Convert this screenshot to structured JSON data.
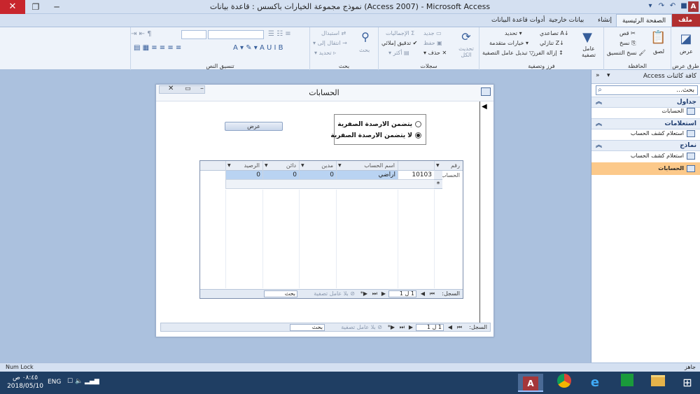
{
  "window": {
    "title": "نموذج مجموعة الخيارات باكسس : قاعدة بيانات (Access 2007) - Microsoft Access",
    "close_glyph": "✕",
    "max_glyph": "❐",
    "min_glyph": "─"
  },
  "ribbon": {
    "tabs": [
      "ملف",
      "الصفحة الرئيسية",
      "إنشاء",
      "بيانات خارجية",
      "أدوات قاعدة البيانات"
    ],
    "groups": {
      "views": {
        "title": "طرق عرض",
        "view_label": "عرض"
      },
      "clipboard": {
        "title": "الحافظة",
        "paste": "لصق",
        "cut": "قص",
        "copy": "نسخ",
        "format_painter": "نسخ التنسيق"
      },
      "sort_filter": {
        "title": "فرز وتصفية",
        "filter": "عامل تصفية",
        "ascending": "تصاعدي",
        "descending": "تنازلي",
        "remove_sort": "إزالة الفرز",
        "selection": "تحديد",
        "advanced": "خيارات متقدمة",
        "toggle_filter": "تبديل عامل التصفية"
      },
      "records": {
        "title": "سجلات",
        "refresh": "تحديث الكل",
        "new": "جديد",
        "save": "حفظ",
        "delete": "حذف",
        "totals": "الإجماليات",
        "spelling": "تدقيق إملائي",
        "more": "أكثر"
      },
      "find": {
        "title": "بحث",
        "find": "بحث",
        "replace": "استبدال",
        "goto": "انتقال إلى",
        "select": "تحديد"
      },
      "text_format": {
        "title": "تنسيق النص"
      }
    }
  },
  "nav_pane": {
    "title": "كافة كائنات Access",
    "search_placeholder": "بحث...",
    "sections": [
      {
        "label": "جداول",
        "items": [
          "الحسابات"
        ]
      },
      {
        "label": "استعلامات",
        "items": [
          "استعلام كشف الحساب"
        ]
      },
      {
        "label": "نماذج",
        "items": [
          "استعلام كشف الحساب",
          "الحسابات"
        ]
      }
    ]
  },
  "form": {
    "title": "الحسابات",
    "options": [
      {
        "label": "يتضمن الارصدة الصفرية",
        "selected": false
      },
      {
        "label": "لا يتضمن الارصدة الصفرية",
        "selected": true
      }
    ],
    "show_button": "عرض",
    "datasheet": {
      "columns": [
        "رقم الحساب",
        "اسم الحساب",
        "مدين",
        "دائن",
        "الرصيد"
      ],
      "rows": [
        [
          "10103",
          "اراضي",
          "0",
          "0",
          "0"
        ]
      ],
      "new_row_marker": "*"
    },
    "sub_nav": {
      "record_label": "السجل:",
      "counter": "1 ل 1",
      "filter": "بلا عامل تصفية",
      "search": "بحث"
    },
    "main_nav": {
      "record_label": "السجل:",
      "counter": "1 ل 1",
      "filter": "بلا عامل تصفية",
      "search": "بحث"
    }
  },
  "statusbar": {
    "left": "Num Lock",
    "right": "جاهز"
  },
  "taskbar": {
    "time": "٠٨:٤٥ ص",
    "date": "2018/05/10",
    "lang": "ENG"
  }
}
